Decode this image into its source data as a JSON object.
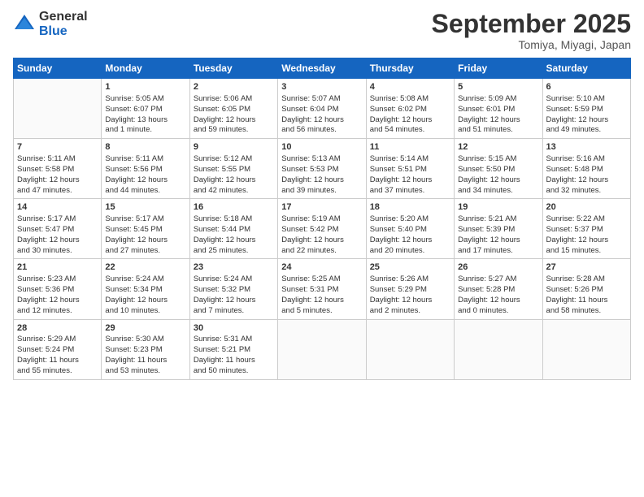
{
  "header": {
    "logo_general": "General",
    "logo_blue": "Blue",
    "month": "September 2025",
    "location": "Tomiya, Miyagi, Japan"
  },
  "columns": [
    "Sunday",
    "Monday",
    "Tuesday",
    "Wednesday",
    "Thursday",
    "Friday",
    "Saturday"
  ],
  "weeks": [
    [
      {
        "day": "",
        "info": ""
      },
      {
        "day": "1",
        "info": "Sunrise: 5:05 AM\nSunset: 6:07 PM\nDaylight: 13 hours\nand 1 minute."
      },
      {
        "day": "2",
        "info": "Sunrise: 5:06 AM\nSunset: 6:05 PM\nDaylight: 12 hours\nand 59 minutes."
      },
      {
        "day": "3",
        "info": "Sunrise: 5:07 AM\nSunset: 6:04 PM\nDaylight: 12 hours\nand 56 minutes."
      },
      {
        "day": "4",
        "info": "Sunrise: 5:08 AM\nSunset: 6:02 PM\nDaylight: 12 hours\nand 54 minutes."
      },
      {
        "day": "5",
        "info": "Sunrise: 5:09 AM\nSunset: 6:01 PM\nDaylight: 12 hours\nand 51 minutes."
      },
      {
        "day": "6",
        "info": "Sunrise: 5:10 AM\nSunset: 5:59 PM\nDaylight: 12 hours\nand 49 minutes."
      }
    ],
    [
      {
        "day": "7",
        "info": "Sunrise: 5:11 AM\nSunset: 5:58 PM\nDaylight: 12 hours\nand 47 minutes."
      },
      {
        "day": "8",
        "info": "Sunrise: 5:11 AM\nSunset: 5:56 PM\nDaylight: 12 hours\nand 44 minutes."
      },
      {
        "day": "9",
        "info": "Sunrise: 5:12 AM\nSunset: 5:55 PM\nDaylight: 12 hours\nand 42 minutes."
      },
      {
        "day": "10",
        "info": "Sunrise: 5:13 AM\nSunset: 5:53 PM\nDaylight: 12 hours\nand 39 minutes."
      },
      {
        "day": "11",
        "info": "Sunrise: 5:14 AM\nSunset: 5:51 PM\nDaylight: 12 hours\nand 37 minutes."
      },
      {
        "day": "12",
        "info": "Sunrise: 5:15 AM\nSunset: 5:50 PM\nDaylight: 12 hours\nand 34 minutes."
      },
      {
        "day": "13",
        "info": "Sunrise: 5:16 AM\nSunset: 5:48 PM\nDaylight: 12 hours\nand 32 minutes."
      }
    ],
    [
      {
        "day": "14",
        "info": "Sunrise: 5:17 AM\nSunset: 5:47 PM\nDaylight: 12 hours\nand 30 minutes."
      },
      {
        "day": "15",
        "info": "Sunrise: 5:17 AM\nSunset: 5:45 PM\nDaylight: 12 hours\nand 27 minutes."
      },
      {
        "day": "16",
        "info": "Sunrise: 5:18 AM\nSunset: 5:44 PM\nDaylight: 12 hours\nand 25 minutes."
      },
      {
        "day": "17",
        "info": "Sunrise: 5:19 AM\nSunset: 5:42 PM\nDaylight: 12 hours\nand 22 minutes."
      },
      {
        "day": "18",
        "info": "Sunrise: 5:20 AM\nSunset: 5:40 PM\nDaylight: 12 hours\nand 20 minutes."
      },
      {
        "day": "19",
        "info": "Sunrise: 5:21 AM\nSunset: 5:39 PM\nDaylight: 12 hours\nand 17 minutes."
      },
      {
        "day": "20",
        "info": "Sunrise: 5:22 AM\nSunset: 5:37 PM\nDaylight: 12 hours\nand 15 minutes."
      }
    ],
    [
      {
        "day": "21",
        "info": "Sunrise: 5:23 AM\nSunset: 5:36 PM\nDaylight: 12 hours\nand 12 minutes."
      },
      {
        "day": "22",
        "info": "Sunrise: 5:24 AM\nSunset: 5:34 PM\nDaylight: 12 hours\nand 10 minutes."
      },
      {
        "day": "23",
        "info": "Sunrise: 5:24 AM\nSunset: 5:32 PM\nDaylight: 12 hours\nand 7 minutes."
      },
      {
        "day": "24",
        "info": "Sunrise: 5:25 AM\nSunset: 5:31 PM\nDaylight: 12 hours\nand 5 minutes."
      },
      {
        "day": "25",
        "info": "Sunrise: 5:26 AM\nSunset: 5:29 PM\nDaylight: 12 hours\nand 2 minutes."
      },
      {
        "day": "26",
        "info": "Sunrise: 5:27 AM\nSunset: 5:28 PM\nDaylight: 12 hours\nand 0 minutes."
      },
      {
        "day": "27",
        "info": "Sunrise: 5:28 AM\nSunset: 5:26 PM\nDaylight: 11 hours\nand 58 minutes."
      }
    ],
    [
      {
        "day": "28",
        "info": "Sunrise: 5:29 AM\nSunset: 5:24 PM\nDaylight: 11 hours\nand 55 minutes."
      },
      {
        "day": "29",
        "info": "Sunrise: 5:30 AM\nSunset: 5:23 PM\nDaylight: 11 hours\nand 53 minutes."
      },
      {
        "day": "30",
        "info": "Sunrise: 5:31 AM\nSunset: 5:21 PM\nDaylight: 11 hours\nand 50 minutes."
      },
      {
        "day": "",
        "info": ""
      },
      {
        "day": "",
        "info": ""
      },
      {
        "day": "",
        "info": ""
      },
      {
        "day": "",
        "info": ""
      }
    ]
  ]
}
